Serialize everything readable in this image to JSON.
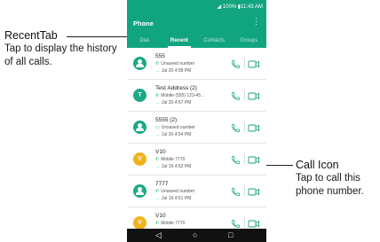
{
  "status_bar": {
    "text": "◢ 100% ▮11:43 AM"
  },
  "app_bar": {
    "title": "Phone",
    "menu_icon": "⋮"
  },
  "tabs": [
    "Dial",
    "Recent",
    "Contacts",
    "Groups"
  ],
  "calls": [
    {
      "avatar_letter": "",
      "avatar_color": "#1ba886",
      "name": "555",
      "line2_icon": "phone-icon",
      "line2": "Unsaved number",
      "line3": "Jul 20 4:58 PM"
    },
    {
      "avatar_letter": "T",
      "avatar_color": "#1ba886",
      "name": "Test Address  (2)",
      "line2_icon": "phone-icon",
      "line2": "Mobile (555) 123-45...",
      "line3": "Jul 20 4:57 PM"
    },
    {
      "avatar_letter": "",
      "avatar_color": "#1ba886",
      "name": "5555  (2)",
      "line2_icon": "message-icon",
      "line2": "Unsaved number",
      "line3": "Jul 20 4:54 PM"
    },
    {
      "avatar_letter": "V",
      "avatar_color": "#f2b21c",
      "name": "V10",
      "line2_icon": "phone-icon",
      "line2": "Mobile 7770",
      "line3": "Jul 19 4:52 PM"
    },
    {
      "avatar_letter": "",
      "avatar_color": "#1ba886",
      "name": "7777",
      "line2_icon": "phone-icon",
      "line2": "Unsaved number",
      "line3": "Jul 19 4:51 PM"
    },
    {
      "avatar_letter": "V",
      "avatar_color": "#f2b21c",
      "name": "V10",
      "line2_icon": "phone-icon",
      "line2": "Mobile 7770",
      "line3": ""
    }
  ],
  "callouts": {
    "recent_tab": {
      "title": "RecentTab",
      "desc": "Tap to display the history of all calls."
    },
    "call_icon": {
      "title": "Call Icon",
      "desc": "Tap to call this phone number."
    }
  },
  "nav": {
    "back": "◁",
    "home": "○",
    "recents": "□"
  },
  "colors": {
    "accent": "#11a57f",
    "avatar_green": "#1ba886",
    "avatar_yellow": "#f2b21c",
    "nav_bar": "#111111"
  }
}
